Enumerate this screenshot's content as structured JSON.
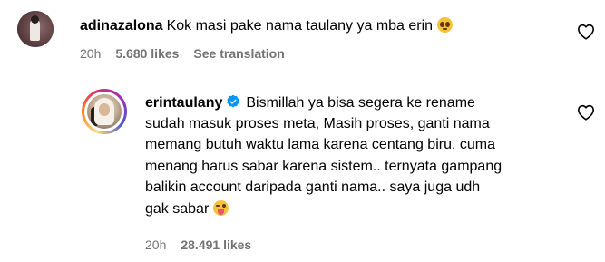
{
  "comments": [
    {
      "username": "adinazalona",
      "text": "Kok masi pake nama taulany ya mba erin",
      "emoji": "pleading-face-emoji",
      "time": "20h",
      "likes": "5.680 likes",
      "see_translation": "See translation",
      "avatar": "profile-photo-adinazalona"
    },
    {
      "username": "erintaulany",
      "verified": true,
      "text_line1": "Bismillah ya bisa segera ke rename",
      "text_lines": [
        "sudah masuk proses meta, Masih proses, ganti nama",
        "memang butuh waktu lama karena centang biru, cuma",
        "menang harus sabar karena sistem.. ternyata gampang",
        "balikin account daripada ganti nama.. saya juga udh",
        "gak sabar"
      ],
      "emoji": "tongue-face-emoji",
      "time": "20h",
      "likes": "28.491 likes",
      "avatar": "profile-photo-erintaulany",
      "story_ring": true
    }
  ],
  "colors": {
    "verified_badge": "#0095f6",
    "meta_text": "#737373",
    "story_ring": [
      "#feda75",
      "#fa7e1e",
      "#d62976",
      "#962fbf",
      "#4f5bd5"
    ]
  },
  "icons": {
    "like": "heart-outline-icon"
  }
}
